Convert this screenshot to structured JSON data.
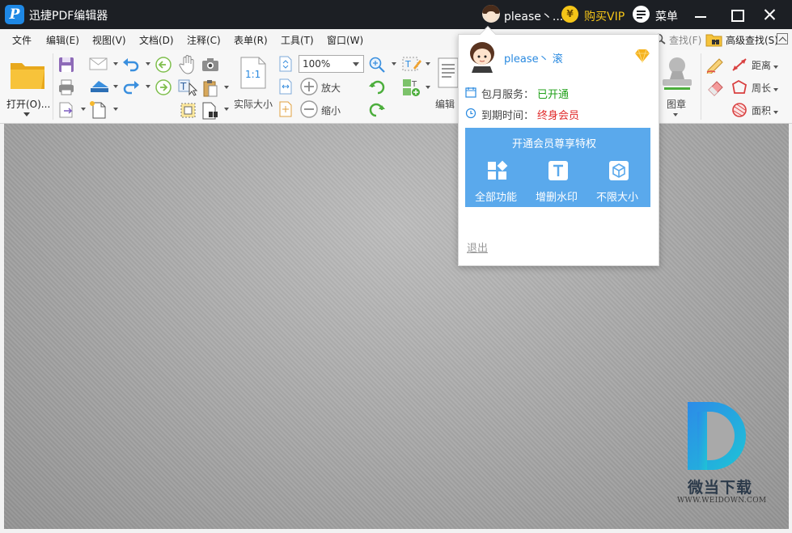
{
  "app": {
    "logo_letter": "P",
    "title": "迅捷PDF编辑器"
  },
  "titlebar": {
    "username": "please丶...",
    "vip_coin": "¥",
    "buy_vip": "购买VIP",
    "menu": "菜单"
  },
  "menubar": {
    "items": [
      "文件",
      "编辑(E)",
      "视图(V)",
      "文档(D)",
      "注释(C)",
      "表单(R)",
      "工具(T)",
      "窗口(W)"
    ],
    "find": "查找(F)",
    "advanced_find": "高级查找(S)"
  },
  "toolbar": {
    "open": "打开(O)...",
    "actual_size": "实际大小",
    "actual_size_icon": "1:1",
    "zoom_value": "100%",
    "zoom_in": "放大",
    "zoom_out": "缩小",
    "edit": "编辑",
    "stamp": "图章",
    "distance": "距离",
    "perimeter": "周长",
    "area": "面积"
  },
  "popup": {
    "username": "please丶 滚",
    "monthly_label": "包月服务：",
    "monthly_value": "已开通",
    "expire_label": "到期时间：",
    "expire_value": "终身会员",
    "vip_title": "开通会员尊享特权",
    "features": [
      "全部功能",
      "增删水印",
      "不限大小"
    ],
    "logout": "退出"
  },
  "watermark": {
    "name": "微当下载",
    "url": "WWW.WEIDOWN.COM"
  },
  "colors": {
    "titlebar": "#1c1f24",
    "accent_blue": "#2a8ae0",
    "vip_gold": "#f5c518",
    "vip_panel": "#5aa9ec",
    "status_green": "#21a11a",
    "status_red": "#e02b2b"
  }
}
